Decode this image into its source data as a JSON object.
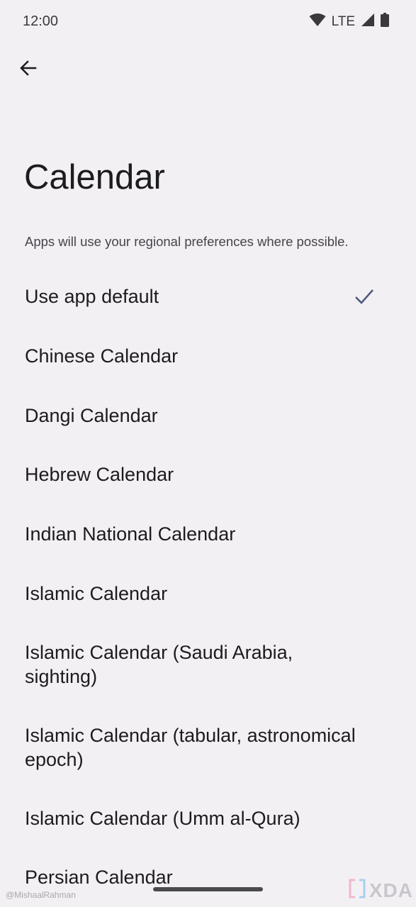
{
  "status_bar": {
    "time": "12:00",
    "network": "LTE"
  },
  "header": {
    "back_icon": "arrow-left-icon"
  },
  "page": {
    "title": "Calendar",
    "subtitle": "Apps will use your regional preferences where possible."
  },
  "options": [
    {
      "label": "Use app default",
      "selected": true
    },
    {
      "label": "Chinese Calendar",
      "selected": false
    },
    {
      "label": "Dangi Calendar",
      "selected": false
    },
    {
      "label": "Hebrew Calendar",
      "selected": false
    },
    {
      "label": "Indian National Calendar",
      "selected": false
    },
    {
      "label": "Islamic Calendar",
      "selected": false
    },
    {
      "label": "Islamic Calendar (Saudi Arabia, sighting)",
      "selected": false
    },
    {
      "label": "Islamic Calendar (tabular, astronomical epoch)",
      "selected": false
    },
    {
      "label": "Islamic Calendar (Umm al-Qura)",
      "selected": false
    },
    {
      "label": "Persian Calendar",
      "selected": false
    }
  ],
  "watermark": {
    "credit": "@MishaalRahman",
    "logo": "XDA"
  },
  "colors": {
    "background": "#f3f0f4",
    "check_accent": "#4f5b7d",
    "text_primary": "#1c1b1f",
    "text_secondary": "#46444a"
  }
}
